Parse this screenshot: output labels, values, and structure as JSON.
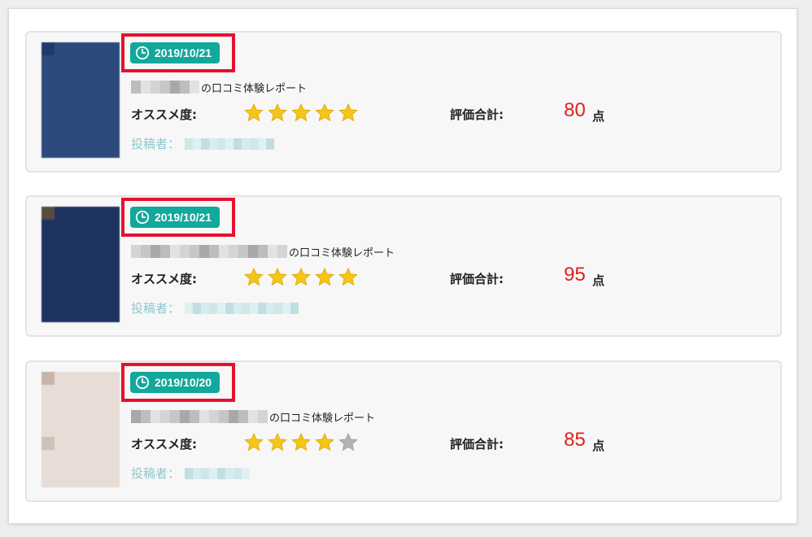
{
  "reviews": [
    {
      "date": "2019/10/21",
      "title_suffix": "の口コミ体験レポート",
      "recommend_label": "オススメ度:",
      "stars": 5,
      "score_label": "評価合計:",
      "score": "80",
      "score_unit": "点",
      "poster_label": "投稿者："
    },
    {
      "date": "2019/10/21",
      "title_suffix": "の口コミ体験レポート",
      "recommend_label": "オススメ度:",
      "stars": 5,
      "score_label": "評価合計:",
      "score": "95",
      "score_unit": "点",
      "poster_label": "投稿者："
    },
    {
      "date": "2019/10/20",
      "title_suffix": "の口コミ体験レポート",
      "recommend_label": "オススメ度:",
      "stars": 4,
      "score_label": "評価合計:",
      "score": "85",
      "score_unit": "点",
      "poster_label": "投稿者："
    }
  ],
  "colors": {
    "date_pill": "#12a89b",
    "highlight_box": "#e6112f",
    "score": "#e0211b",
    "star_on": "#f5c518",
    "star_off": "#b3b3b3",
    "poster": "#8cc7cc"
  },
  "icons": {
    "clock": "clock-icon",
    "star": "star-icon"
  }
}
